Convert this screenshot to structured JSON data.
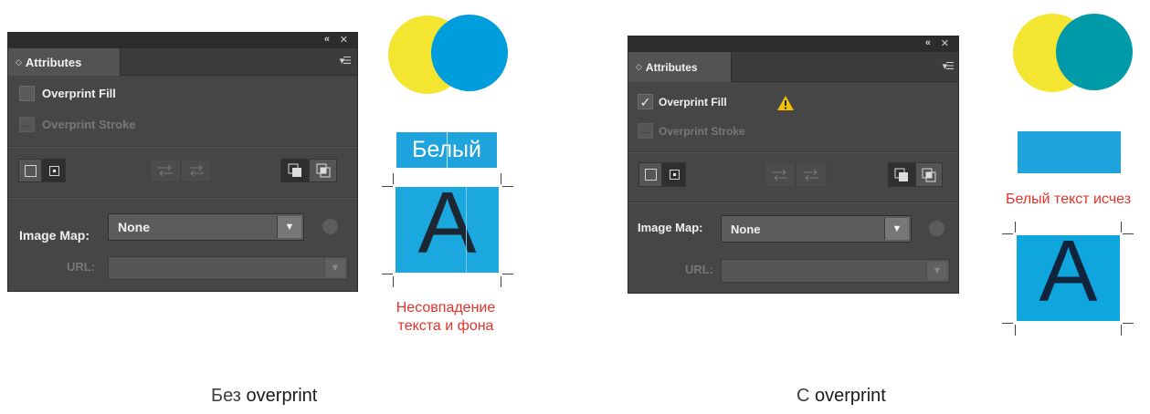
{
  "left": {
    "panel": {
      "collapse_icon": "double-chevron-left-icon",
      "close_icon": "close-icon",
      "tab_icon": "updown-arrows-icon",
      "tab_label": "Attributes",
      "menu_icon": "panel-menu-icon",
      "overprint_fill": {
        "label": "Overprint Fill",
        "checked": false
      },
      "overprint_stroke": {
        "label": "Overprint Stroke",
        "enabled": false
      },
      "image_map_label": "Image Map:",
      "image_map_value": "None",
      "url_label": "URL:",
      "url_value": ""
    },
    "colors": {
      "circle_left": "#f4e531",
      "circle_right": "#009ddd"
    },
    "text_bar": "Белый",
    "letter": "A",
    "note": [
      "Несовпадение",
      "текста и фона"
    ],
    "caption_prefix": "Без",
    "caption_word": "overprint"
  },
  "right": {
    "panel": {
      "collapse_icon": "double-chevron-left-icon",
      "close_icon": "close-icon",
      "tab_icon": "updown-arrows-icon",
      "tab_label": "Attributes",
      "menu_icon": "panel-menu-icon",
      "overprint_fill": {
        "label": "Overprint Fill",
        "checked": true
      },
      "warning_icon": "warning-icon",
      "overprint_stroke": {
        "label": "Overprint Stroke",
        "enabled": false
      },
      "image_map_label": "Image Map:",
      "image_map_value": "None",
      "url_label": "URL:",
      "url_value": ""
    },
    "colors": {
      "circle_left": "#f4e531",
      "circle_right": "#009aa8"
    },
    "note": "Белый текст исчез",
    "letter": "A",
    "caption_prefix": "С",
    "caption_word": "overprint"
  }
}
